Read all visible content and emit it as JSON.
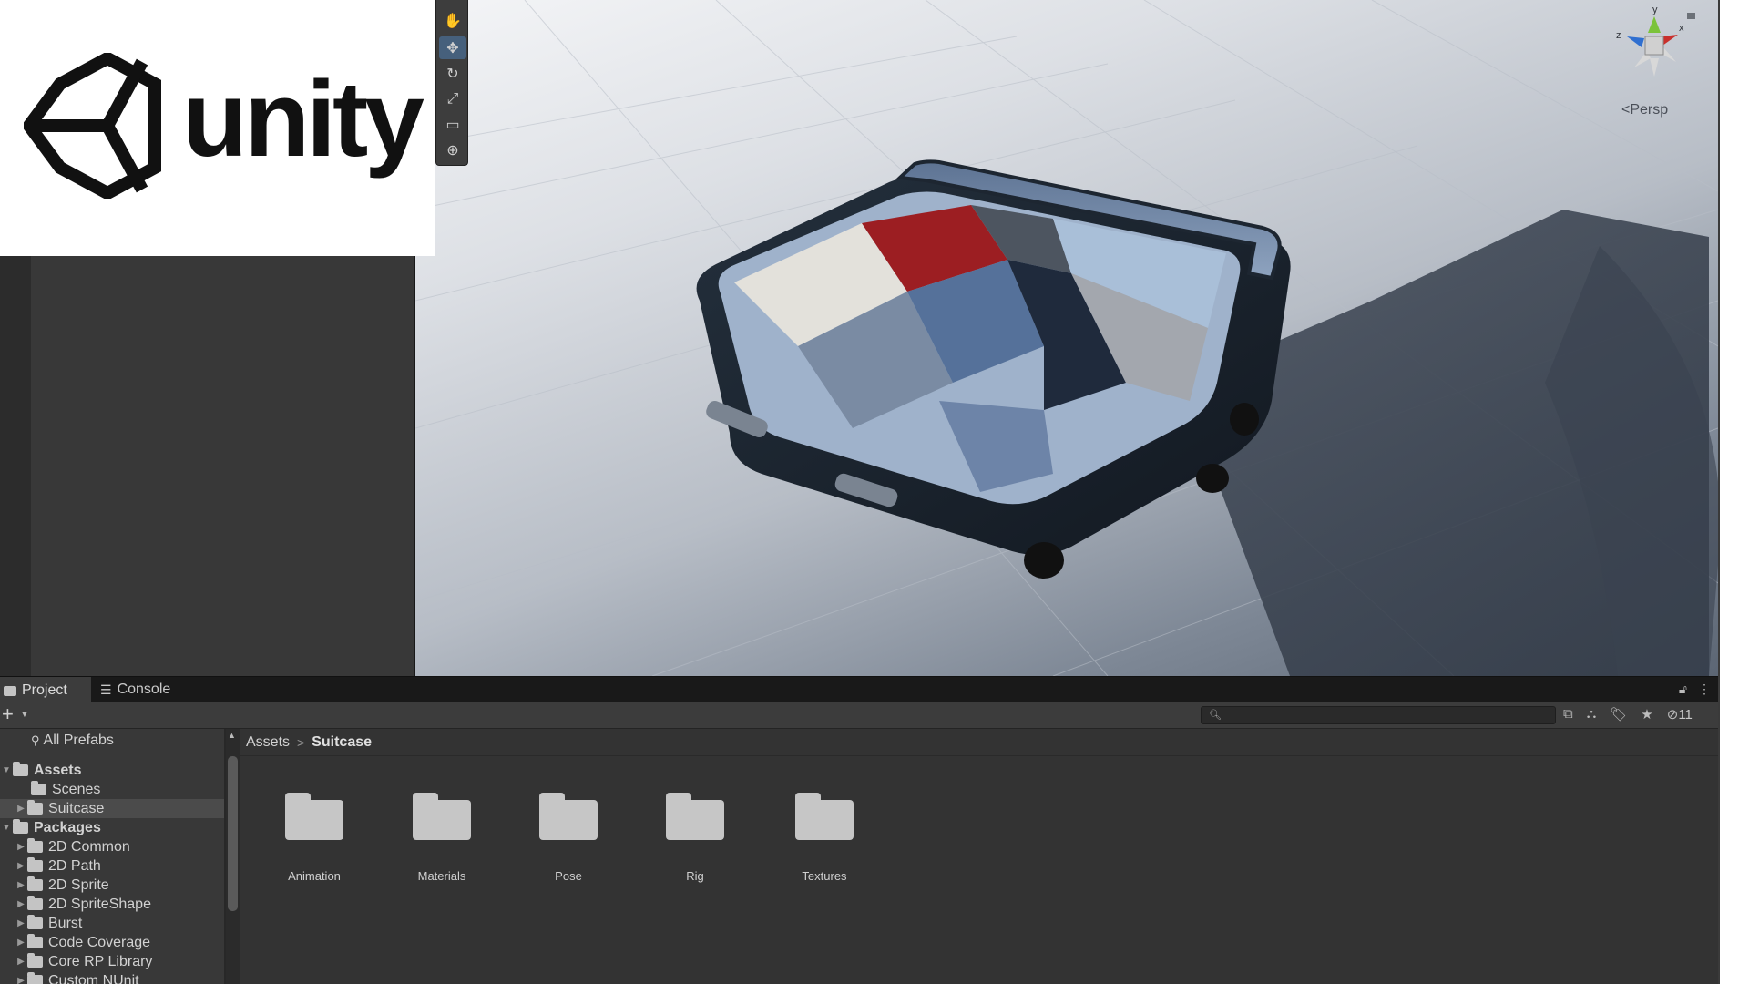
{
  "logo": {
    "text": "unity"
  },
  "scene": {
    "view_mode": "Persp",
    "gizmo_axes": {
      "y": "y",
      "x": "x",
      "z": "z"
    }
  },
  "tools": [
    {
      "name": "hand-tool-icon"
    },
    {
      "name": "move-tool-icon"
    },
    {
      "name": "rotate-tool-icon"
    },
    {
      "name": "scale-tool-icon"
    },
    {
      "name": "rect-tool-icon"
    },
    {
      "name": "transform-tool-icon"
    }
  ],
  "tabs": {
    "project": "Project",
    "console": "Console"
  },
  "toolbar": {
    "add": "+",
    "hidden_count": "11"
  },
  "tree": {
    "favorites": "All Prefabs",
    "assets": "Assets",
    "assets_children": [
      "Scenes",
      "Suitcase"
    ],
    "packages": "Packages",
    "packages_children": [
      "2D Common",
      "2D Path",
      "2D Sprite",
      "2D SpriteShape",
      "Burst",
      "Code Coverage",
      "Core RP Library",
      "Custom NUnit"
    ]
  },
  "breadcrumb": {
    "root": "Assets",
    "separator": ">",
    "current": "Suitcase"
  },
  "folders": [
    "Animation",
    "Materials",
    "Pose",
    "Rig",
    "Textures"
  ],
  "colors": {
    "accent": "#46607c",
    "panel": "#383838",
    "selection": "#4b4b4b"
  }
}
